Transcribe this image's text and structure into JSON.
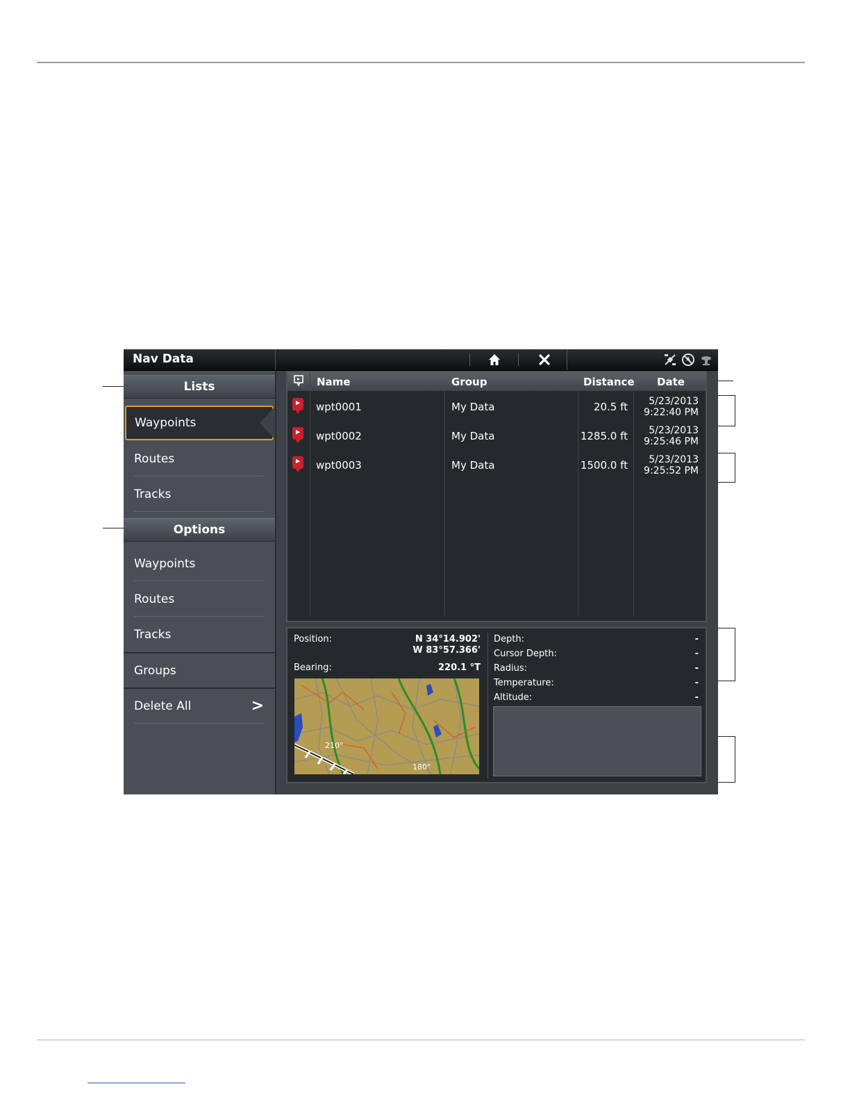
{
  "window": {
    "title": "Nav Data",
    "icons": [
      "home-icon",
      "close-icon",
      "gps-icon",
      "compass-off-icon",
      "satellite-icon"
    ]
  },
  "lists": {
    "header": "Lists",
    "items": [
      {
        "label": "Waypoints",
        "selected": true
      },
      {
        "label": "Routes"
      },
      {
        "label": "Tracks"
      }
    ]
  },
  "options": {
    "header": "Options",
    "items": [
      {
        "label": "Waypoints"
      },
      {
        "label": "Routes"
      },
      {
        "label": "Tracks"
      }
    ]
  },
  "groups_label": "Groups",
  "delete_all_label": "Delete All",
  "table": {
    "columns": [
      "Name",
      "Group",
      "Distance",
      "Date"
    ],
    "rows": [
      {
        "name": "wpt0001",
        "group": "My Data",
        "distance": "20.5 ft",
        "date": "5/23/2013",
        "time": "9:22:40 PM"
      },
      {
        "name": "wpt0002",
        "group": "My Data",
        "distance": "1285.0 ft",
        "date": "5/23/2013",
        "time": "9:25:46 PM"
      },
      {
        "name": "wpt0003",
        "group": "My Data",
        "distance": "1500.0 ft",
        "date": "5/23/2013",
        "time": "9:25:52 PM"
      }
    ]
  },
  "info": {
    "position_label": "Position:",
    "position_lat": "N 34°14.902'",
    "position_lon": "W 83°57.366'",
    "bearing_label": "Bearing:",
    "bearing_value": "220.1 °T",
    "depth_label": "Depth:",
    "depth_value": "-",
    "cursor_depth_label": "Cursor Depth:",
    "cursor_depth_value": "-",
    "radius_label": "Radius:",
    "radius_value": "-",
    "temperature_label": "Temperature:",
    "temperature_value": "-",
    "altitude_label": "Altitude:",
    "altitude_value": "-"
  },
  "map": {
    "heading_label_1": "210°",
    "heading_label_2": "180°"
  },
  "colors": {
    "selection_border": "#e39b2a",
    "waypoint_pin": "#c9202c",
    "screen_bg": "#3d4247"
  }
}
